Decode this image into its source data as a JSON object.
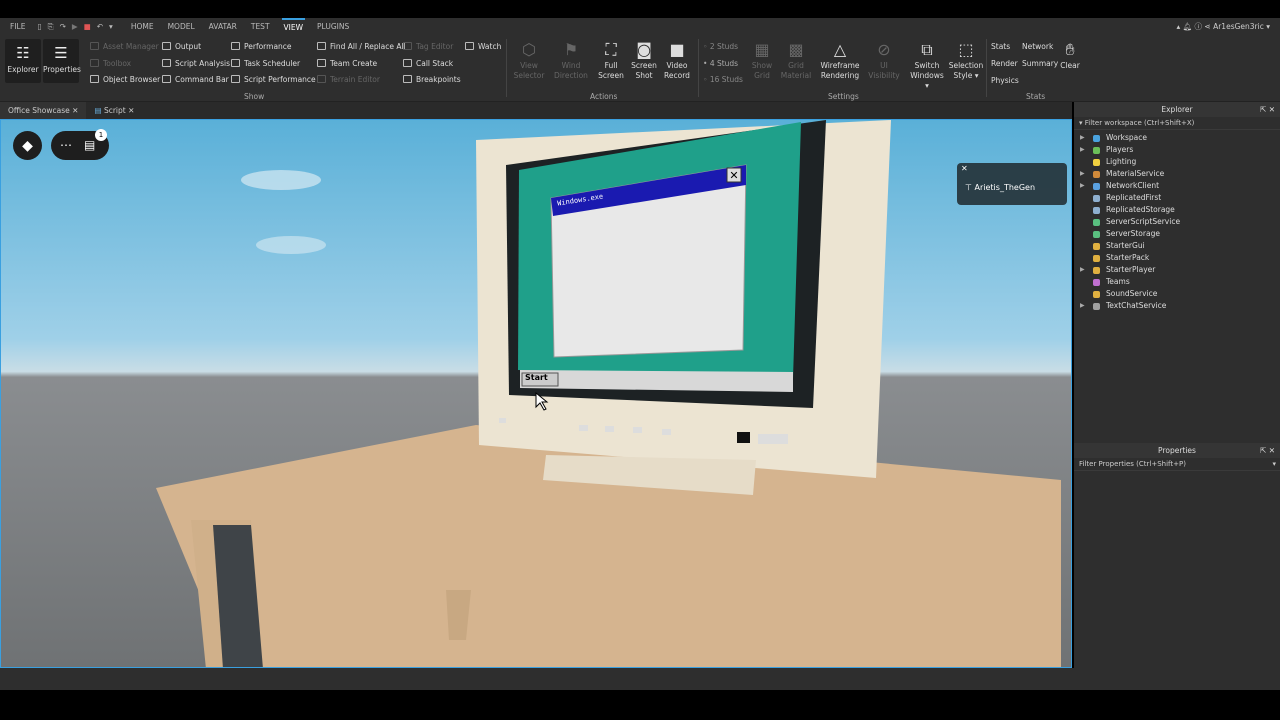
{
  "menubar": {
    "file": "FILE",
    "tabs": [
      "HOME",
      "MODEL",
      "AVATAR",
      "TEST",
      "VIEW",
      "PLUGINS"
    ],
    "active": "VIEW",
    "user": "Ar1esGen3ric"
  },
  "ribbon": {
    "explorer": "Explorer",
    "properties": "Properties",
    "show_col1": [
      "Asset Manager",
      "Toolbox",
      "Object Browser"
    ],
    "show_col2": [
      "Output",
      "Script Analysis",
      "Command Bar"
    ],
    "show_col3": [
      "Performance",
      "Task Scheduler",
      "Script Performance"
    ],
    "show_col4": [
      "Find All / Replace All",
      "Team Create",
      "Terrain Editor"
    ],
    "show_col5": [
      "Tag Editor",
      "Call Stack",
      "Breakpoints"
    ],
    "watch": "Watch",
    "show_label": "Show",
    "actions": [
      [
        "View",
        "Selector"
      ],
      [
        "Wind",
        "Direction"
      ],
      [
        "Full",
        "Screen"
      ],
      [
        "Screen",
        "Shot"
      ],
      [
        "Video",
        "Record"
      ]
    ],
    "actions_label": "Actions",
    "studs": [
      "2 Studs",
      "4 Studs",
      "16 Studs"
    ],
    "settings": [
      [
        "Show",
        "Grid"
      ],
      [
        "Grid",
        "Material"
      ],
      [
        "Wireframe",
        "Rendering"
      ],
      [
        "UI Visibility",
        ""
      ],
      [
        "Switch",
        "Windows ▾"
      ],
      [
        "Selection",
        "Style ▾"
      ]
    ],
    "settings_label": "Settings",
    "stats": [
      "Stats",
      "Network",
      "Render",
      "Summary",
      "Physics"
    ],
    "clear": "Clear",
    "stats_label": "Stats"
  },
  "doc_tabs": [
    "Office Showcase",
    "Script"
  ],
  "viewport": {
    "notification_count": "1",
    "player_name": "Arietis_TheGen",
    "window_title": "Windows.exe",
    "start_label": "Start"
  },
  "explorer": {
    "title": "Explorer",
    "filter": "Filter workspace (Ctrl+Shift+X)",
    "items": [
      {
        "label": "Workspace",
        "expand": true,
        "color": "#4aa3df"
      },
      {
        "label": "Players",
        "expand": true,
        "color": "#6bbf59"
      },
      {
        "label": "Lighting",
        "expand": false,
        "color": "#f0d040"
      },
      {
        "label": "MaterialService",
        "expand": true,
        "color": "#d08a3a"
      },
      {
        "label": "NetworkClient",
        "expand": true,
        "color": "#5aa0e0"
      },
      {
        "label": "ReplicatedFirst",
        "expand": false,
        "color": "#8fb0d0"
      },
      {
        "label": "ReplicatedStorage",
        "expand": false,
        "color": "#8fb0d0"
      },
      {
        "label": "ServerScriptService",
        "expand": false,
        "color": "#5ac080"
      },
      {
        "label": "ServerStorage",
        "expand": false,
        "color": "#5ac080"
      },
      {
        "label": "StarterGui",
        "expand": false,
        "color": "#e0b040"
      },
      {
        "label": "StarterPack",
        "expand": false,
        "color": "#e0b040"
      },
      {
        "label": "StarterPlayer",
        "expand": true,
        "color": "#e0b040"
      },
      {
        "label": "Teams",
        "expand": false,
        "color": "#c070d0"
      },
      {
        "label": "SoundService",
        "expand": false,
        "color": "#e0b040"
      },
      {
        "label": "TextChatService",
        "expand": true,
        "color": "#a0a0a0"
      }
    ]
  },
  "properties": {
    "title": "Properties",
    "filter": "Filter Properties (Ctrl+Shift+P)"
  }
}
